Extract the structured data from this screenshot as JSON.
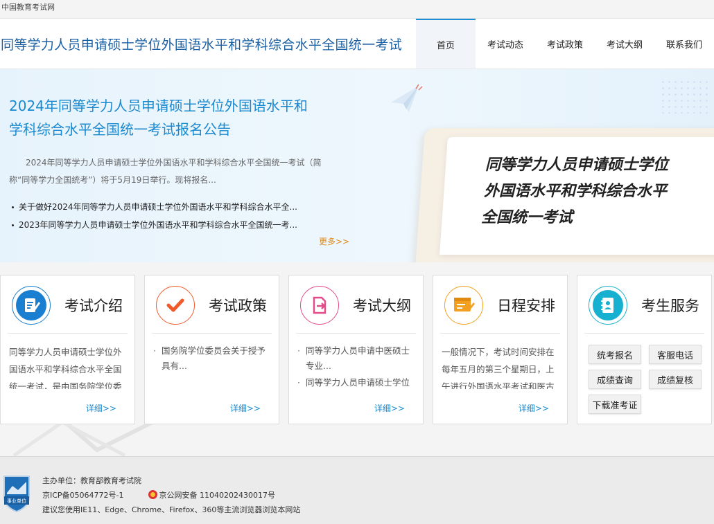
{
  "topbar": {
    "site_name": "中国教育考试网"
  },
  "header": {
    "title": "同等学力人员申请硕士学位外国语水平和学科综合水平全国统一考试",
    "nav": [
      {
        "label": "首页",
        "active": true
      },
      {
        "label": "考试动态",
        "active": false
      },
      {
        "label": "考试政策",
        "active": false
      },
      {
        "label": "考试大纲",
        "active": false
      },
      {
        "label": "联系我们",
        "active": false
      }
    ]
  },
  "banner": {
    "headline_line1": "2024年同等学力人员申请硕士学位外国语水平和",
    "headline_line2": "学科综合水平全国统一考试报名公告",
    "description": "2024年同等学力人员申请硕士学位外国语水平和学科综合水平全国统一考试（简称“同等学力全国统考”）将于5月19日举行。现将报名...",
    "news": [
      "关于做好2024年同等学力人员申请硕士学位外国语水平和学科综合水平全...",
      "2023年同等学力人员申请硕士学位外国语水平和学科综合水平全国统一考..."
    ],
    "more_label": "更多>>",
    "card_lines": [
      "同等学力人员申请硕士学位",
      "外国语水平和学科综合水平",
      "全国统一考试"
    ]
  },
  "services": [
    {
      "title": "考试介绍",
      "icon": "document-edit-icon",
      "color": "#1a7fd0",
      "text": "同等学力人员申请硕士学位外国语水平和学科综合水平全国统一考试，是由国务院学位委",
      "detail": "详细>>"
    },
    {
      "title": "考试政策",
      "icon": "checkmark-icon",
      "color": "#f05a2a",
      "list": [
        "国务院学位委员会关于授予具有..."
      ],
      "detail": "详细>>"
    },
    {
      "title": "考试大纲",
      "icon": "file-export-icon",
      "color": "#e24a8a",
      "list": [
        "同等学力人员申请中医硕士专业...",
        "同等学力人员申请硕士学位外..."
      ],
      "detail": "详细>>"
    },
    {
      "title": "日程安排",
      "icon": "schedule-icon",
      "color": "#f2a020",
      "text": "一般情况下，考试时间安排在每年五月的第三个星期日，上午进行外国语水平考试和医古",
      "detail": "详细>>"
    },
    {
      "title": "考生服务",
      "icon": "contact-book-icon",
      "color": "#18b0d0",
      "buttons": [
        "统考报名",
        "客服电话",
        "成绩查询",
        "成绩复核",
        "下载准考证"
      ]
    }
  ],
  "footer": {
    "host": "主办单位：教育部教育考试院",
    "icp": "京ICP备05064772号-1",
    "police": "京公网安备 11040202430017号",
    "browser": "建议您使用IE11、Edge、Chrome、Firefox、360等主流浏览器浏览本网站",
    "badge_text": "事业单位"
  }
}
